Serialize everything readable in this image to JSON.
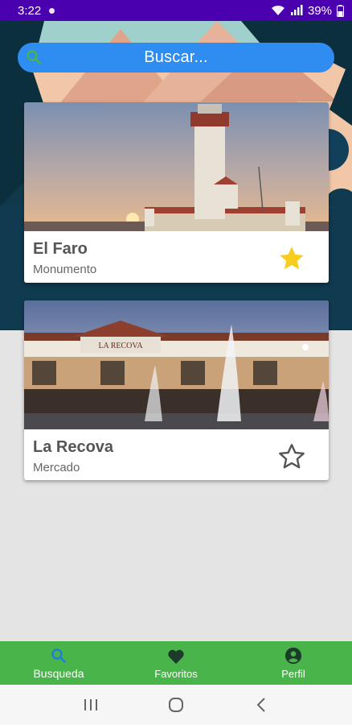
{
  "status_bar": {
    "time": "3:22",
    "battery": "39%"
  },
  "search": {
    "placeholder": "Buscar..."
  },
  "places": [
    {
      "name": "El Faro",
      "category": "Monumento",
      "favorite": true
    },
    {
      "name": "La Recova",
      "category": "Mercado",
      "favorite": false
    }
  ],
  "bottom_nav": {
    "items": [
      {
        "label": "Busqueda",
        "icon": "search-icon",
        "active": true
      },
      {
        "label": "Favoritos",
        "icon": "heart-icon",
        "active": false
      },
      {
        "label": "Perfil",
        "icon": "account-icon",
        "active": false
      }
    ]
  },
  "colors": {
    "status_bar": "#4b00b0",
    "search_bar": "#2f8cf0",
    "bottom_nav": "#49b44a",
    "active_nav": "#1e7fd6",
    "favorite_star": "#f7cd1e",
    "hero_bg": "#f2c7a8"
  },
  "sign_text": "LA RECOVA"
}
